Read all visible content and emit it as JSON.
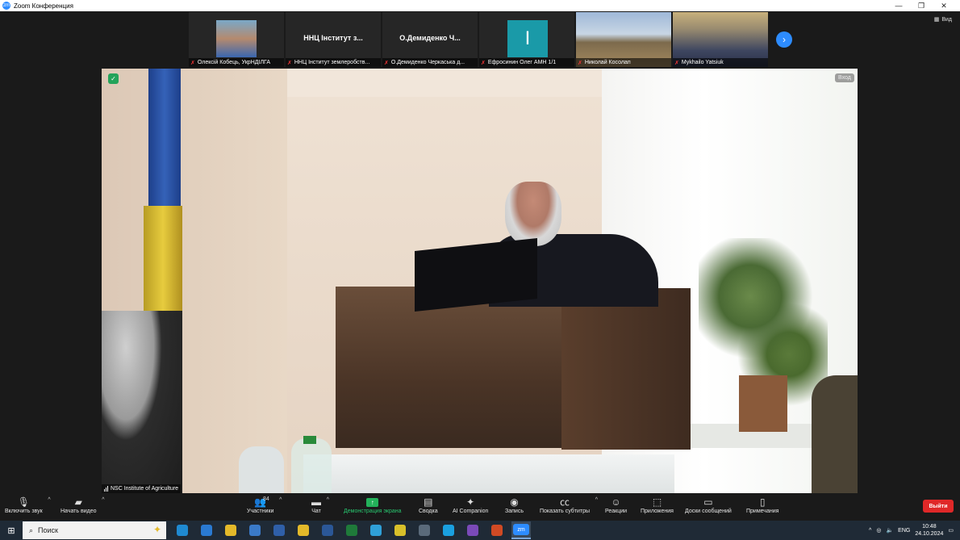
{
  "window": {
    "title": "Zoom Конференция",
    "app_icon": "zm",
    "controls": [
      "—",
      "❐",
      "✕"
    ]
  },
  "view_button": {
    "label": "Вид",
    "icon": "grid-icon"
  },
  "participants_strip": [
    {
      "name": "Олексій Кобець, УкрНДІЛГА",
      "muted": true,
      "display": "photo"
    },
    {
      "name": "ННЦ Інститут землеробств...",
      "muted": true,
      "display": "text",
      "big_text": "ННЦ Інститут з..."
    },
    {
      "name": "О.Демиденко Черкаська д...",
      "muted": true,
      "display": "text",
      "big_text": "О.Демиденко Ч..."
    },
    {
      "name": "Ефросинин Олег АМН 1/1",
      "muted": true,
      "display": "letter",
      "letter": "I",
      "color": "#1a9aa8"
    },
    {
      "name": "Николай Косолап",
      "muted": true,
      "display": "photo-field"
    },
    {
      "name": "Mykhailo Yatsiuk",
      "muted": true,
      "display": "photo-man"
    }
  ],
  "strip_next_icon": "chevron-right-icon",
  "main_video": {
    "security_icon": "shield-check-icon",
    "corner_badge": "Вход",
    "speaker_label": "NSC Institute of Agriculture",
    "signal_icon": "signal-bars-icon"
  },
  "toolbar": {
    "audio": {
      "label": "Включить звук",
      "icon": "mic-muted-icon"
    },
    "video": {
      "label": "Начать видео",
      "icon": "video-off-icon"
    },
    "participants": {
      "label": "Участники",
      "count": "84",
      "icon": "participants-icon"
    },
    "chat": {
      "label": "Чат",
      "icon": "chat-icon"
    },
    "share": {
      "label": "Демонстрация экрана",
      "icon": "share-screen-icon",
      "color": "#28c76f"
    },
    "summary": {
      "label": "Сводка",
      "icon": "summary-icon"
    },
    "ai": {
      "label": "AI Companion",
      "icon": "sparkle-icon"
    },
    "record": {
      "label": "Запись",
      "icon": "record-icon"
    },
    "captions": {
      "label": "Показать субтитры",
      "icon": "cc-icon"
    },
    "reactions": {
      "label": "Реакции",
      "icon": "reactions-icon"
    },
    "apps": {
      "label": "Приложения",
      "icon": "apps-icon"
    },
    "whiteboards": {
      "label": "Доски сообщений",
      "icon": "whiteboard-icon"
    },
    "notes": {
      "label": "Примечания",
      "icon": "notes-icon"
    },
    "leave": {
      "label": "Выйти",
      "color": "#e02828"
    }
  },
  "taskbar": {
    "search_placeholder": "Поиск",
    "apps": [
      {
        "name": "edge",
        "color": "#1f8ad2"
      },
      {
        "name": "outlook-mail",
        "color": "#2a7ad2"
      },
      {
        "name": "chrome",
        "color": "#e3b92a"
      },
      {
        "name": "thunderbird",
        "color": "#3a7ac8"
      },
      {
        "name": "floppy-save",
        "color": "#2f5fa8"
      },
      {
        "name": "file-explorer",
        "color": "#e3b92a"
      },
      {
        "name": "word",
        "color": "#2b5797"
      },
      {
        "name": "excel",
        "color": "#1f7a3a"
      },
      {
        "name": "telegram",
        "color": "#2fa0d8"
      },
      {
        "name": "notes",
        "color": "#d8c02a"
      },
      {
        "name": "calculator",
        "color": "#5a6a7a"
      },
      {
        "name": "skype",
        "color": "#1aa0e0"
      },
      {
        "name": "viber",
        "color": "#7a4ab8"
      },
      {
        "name": "powerpoint",
        "color": "#d04a24"
      },
      {
        "name": "zoom",
        "color": "#2d8cff",
        "label": "zm",
        "active": true
      }
    ],
    "tray": {
      "language": "ENG",
      "time": "10:48",
      "date": "24.10.2024"
    }
  }
}
